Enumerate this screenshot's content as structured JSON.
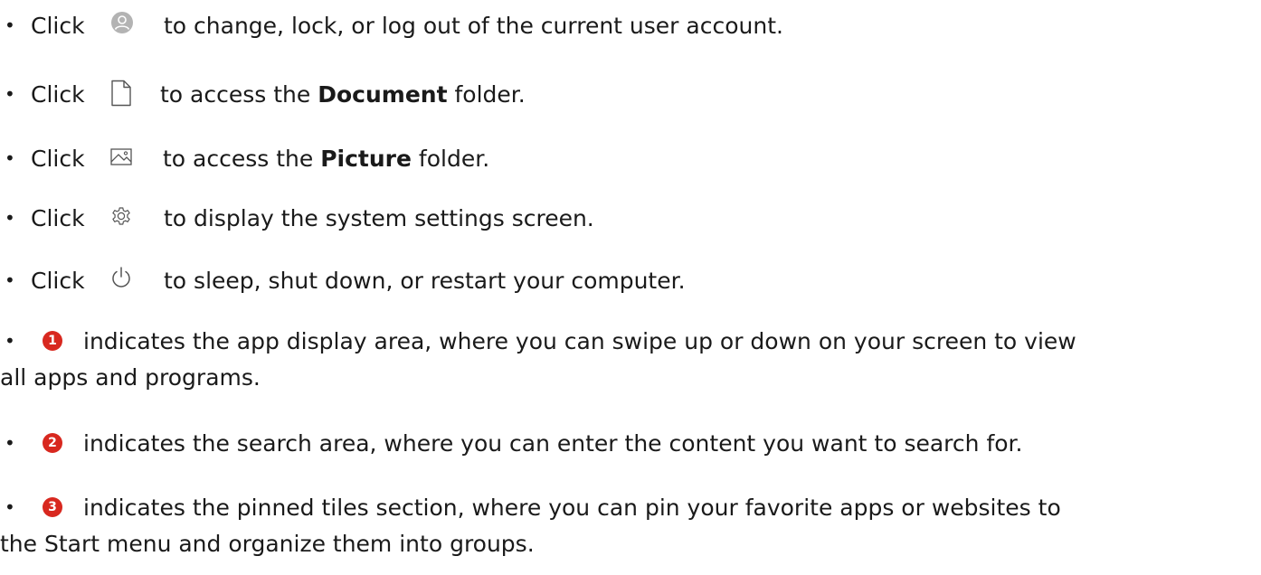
{
  "items": [
    {
      "prefix": "Click",
      "icon": "user-avatar-icon",
      "text": "to change, lock, or log out of the current user account."
    },
    {
      "prefix": "Click",
      "icon": "document-icon",
      "text_before": "to access the ",
      "bold": "Document",
      "text_after": " folder."
    },
    {
      "prefix": "Click",
      "icon": "picture-icon",
      "text_before": "to access the ",
      "bold": "Picture",
      "text_after": " folder."
    },
    {
      "prefix": "Click",
      "icon": "settings-gear-icon",
      "text": "to display the system settings screen."
    },
    {
      "prefix": "Click",
      "icon": "power-icon",
      "text": "to sleep, shut down, or restart your computer."
    },
    {
      "badge": "1",
      "text": "indicates the app display area, where you can swipe up or down on your screen to view",
      "text2": "all apps and programs."
    },
    {
      "badge": "2",
      "text": "indicates the search area, where you can enter the content you want to search for."
    },
    {
      "badge": "3",
      "text": "indicates the pinned tiles section, where you can pin your favorite apps or websites to",
      "text2": "the Start menu and organize them into groups."
    }
  ],
  "colors": {
    "badge": "#d8281f",
    "icon": "#666666",
    "text": "#1a1a1a"
  }
}
